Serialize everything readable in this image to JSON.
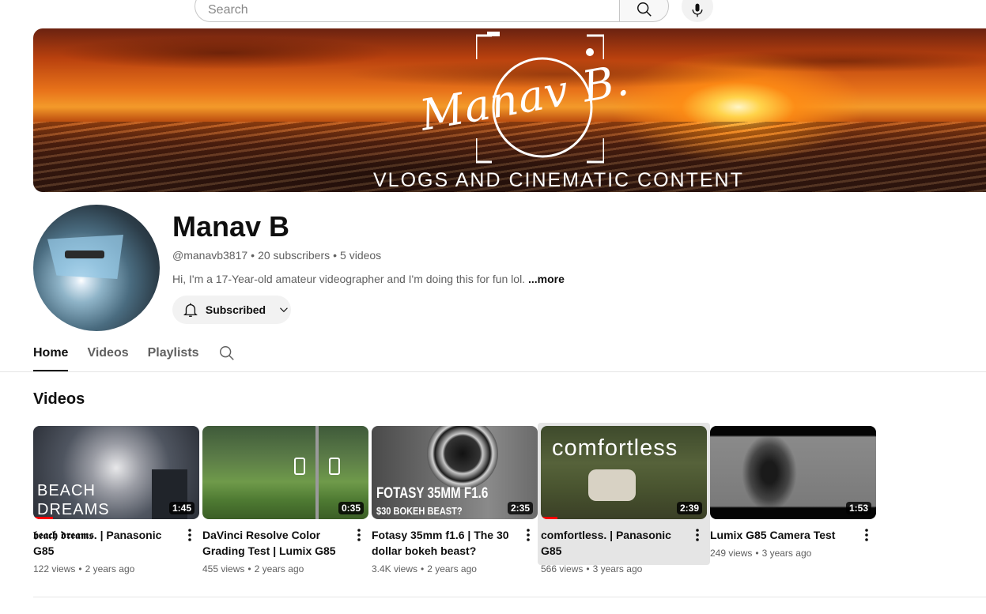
{
  "search": {
    "placeholder": "Search"
  },
  "banner": {
    "signature": "Manav B.",
    "tagline": "VLOGS AND CINEMATIC CONTENT"
  },
  "channel": {
    "name": "Manav B",
    "handle": "@manavb3817",
    "subscribers": "20 subscribers",
    "videos_count": "5 videos",
    "separator": "•",
    "description": "Hi, I'm a 17-Year-old amateur videographer and I'm doing this for fun lol.",
    "more_label": "...more",
    "subscribe_label": "Subscribed"
  },
  "tabs": [
    {
      "label": "Home",
      "active": true
    },
    {
      "label": "Videos",
      "active": false
    },
    {
      "label": "Playlists",
      "active": false
    }
  ],
  "section_title": "Videos",
  "videos": [
    {
      "title": "𝖇𝖊𝖆𝖈𝖍 𝖉𝖗𝖊𝖆𝖒𝖘. | Panasonic G85",
      "views": "122 views",
      "age": "2 years ago",
      "duration": "1:45",
      "overlay": [
        "BEACH",
        "DREAMS"
      ],
      "progress": 0.12
    },
    {
      "title": "DaVinci Resolve Color Grading Test | Lumix G85",
      "views": "455 views",
      "age": "2 years ago",
      "duration": "0:35"
    },
    {
      "title": "Fotasy 35mm f1.6 | The 30 dollar bokeh beast?",
      "views": "3.4K views",
      "age": "2 years ago",
      "duration": "2:35",
      "overlay": [
        "FOTASY 35MM F1.6",
        "$30 BOKEH BEAST?"
      ]
    },
    {
      "title": "comfortless. | Panasonic G85",
      "views": "566 views",
      "age": "3 years ago",
      "duration": "2:39",
      "overlay": [
        "comfortless"
      ],
      "progress": 0.1
    },
    {
      "title": "Lumix G85 Camera Test",
      "views": "249 views",
      "age": "3 years ago",
      "duration": "1:53"
    }
  ],
  "colors": {
    "accent": "#ff0000",
    "text_primary": "#0f0f0f",
    "text_secondary": "#606060"
  },
  "icons": {
    "search": "search-icon",
    "mic": "microphone-icon",
    "bell": "bell-icon",
    "chevron": "chevron-down-icon",
    "more": "more-vert-icon"
  }
}
